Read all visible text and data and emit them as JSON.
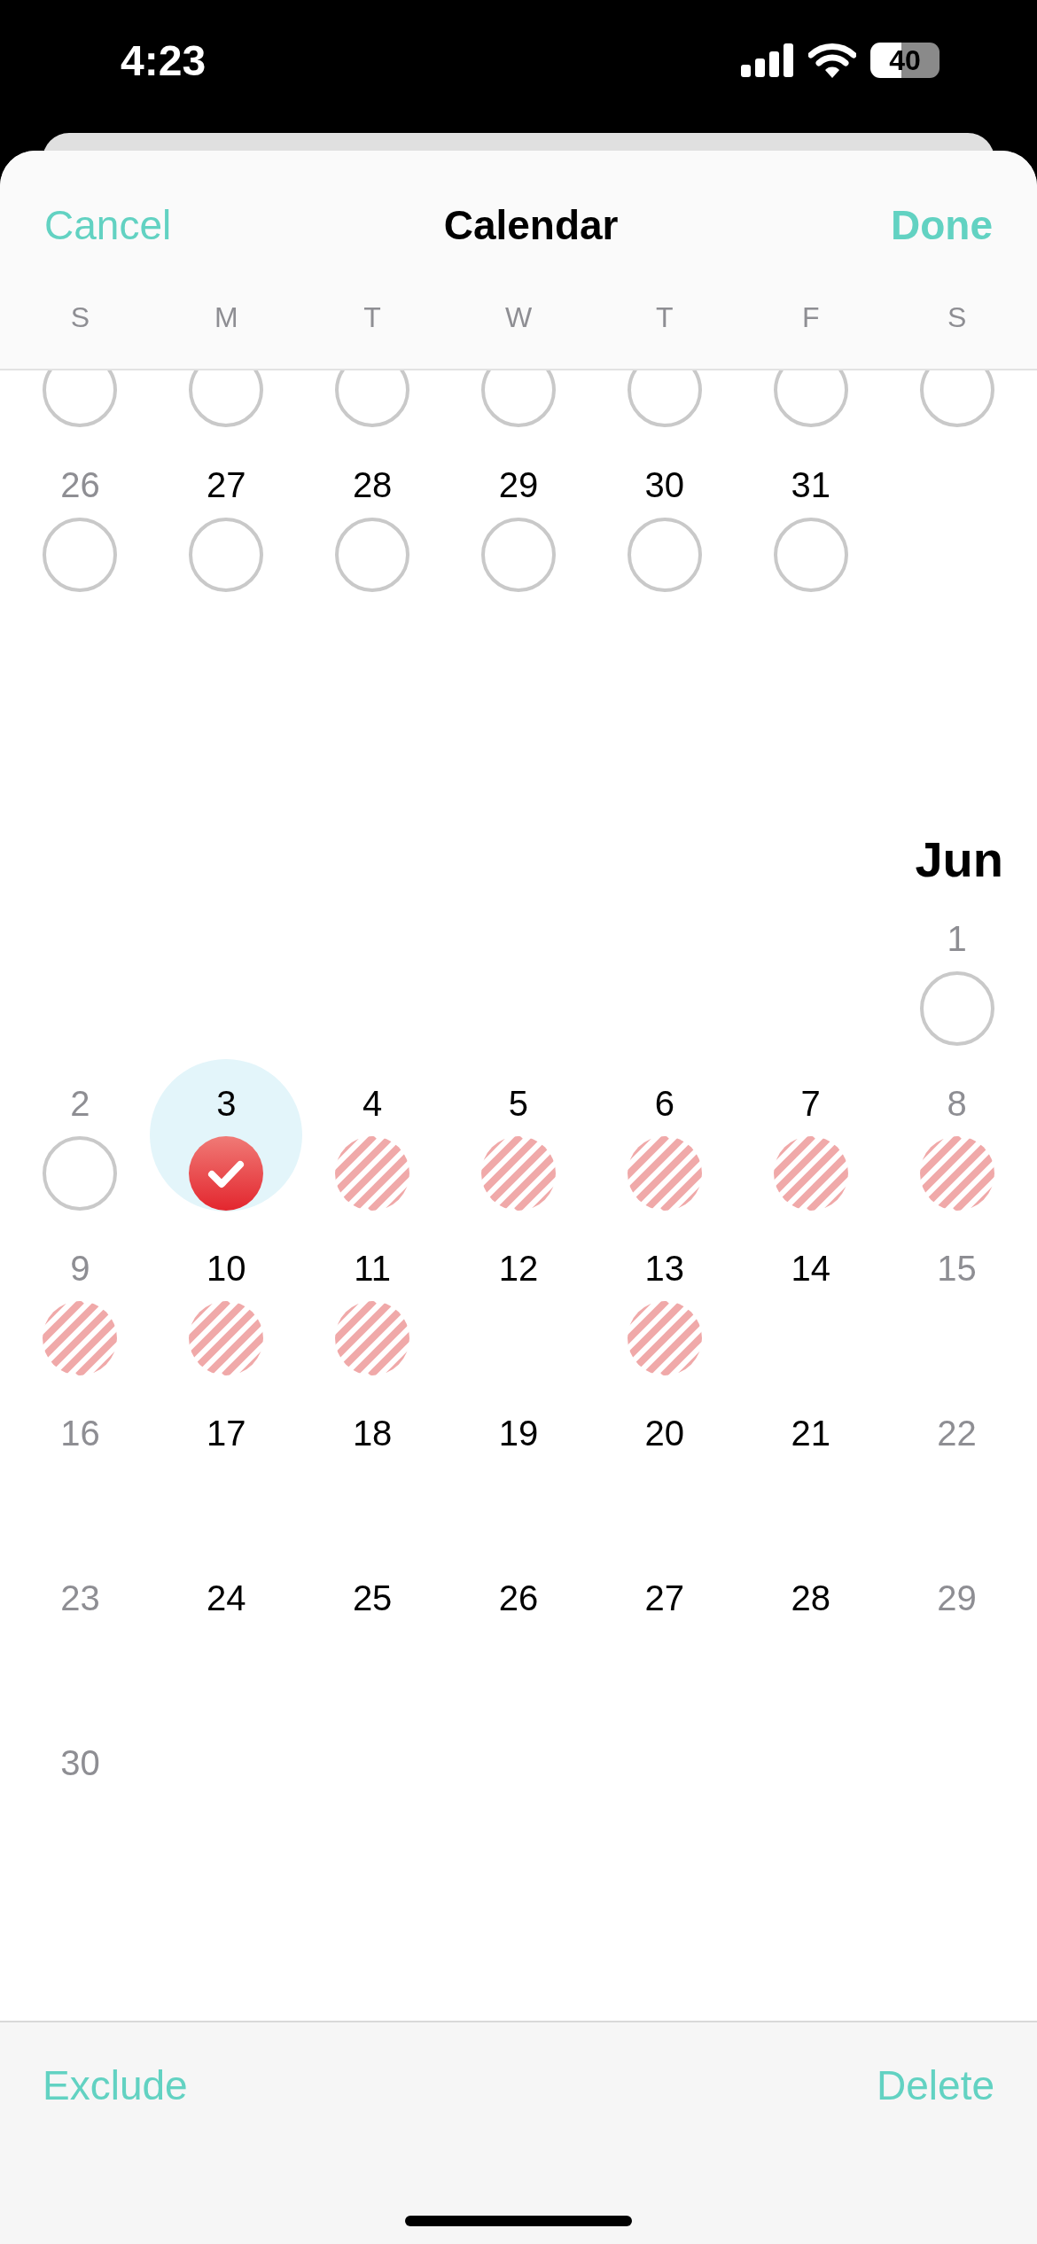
{
  "status_bar": {
    "time": "4:23",
    "battery": "40"
  },
  "header": {
    "cancel": "Cancel",
    "title": "Calendar",
    "done": "Done"
  },
  "weekdays": [
    "S",
    "M",
    "T",
    "W",
    "T",
    "F",
    "S"
  ],
  "months": [
    {
      "weeks": [
        [
          {
            "kind": "open"
          },
          {
            "kind": "open"
          },
          {
            "kind": "open"
          },
          {
            "kind": "open"
          },
          {
            "kind": "open"
          },
          {
            "kind": "open"
          },
          {
            "kind": "open"
          }
        ],
        [
          {
            "day": "26",
            "muted": true,
            "kind": "open",
            "selected": false
          },
          {
            "day": "27",
            "muted": false,
            "kind": "open",
            "selected": false
          },
          {
            "day": "28",
            "muted": false,
            "kind": "open",
            "selected": false
          },
          {
            "day": "29",
            "muted": false,
            "kind": "open",
            "selected": false
          },
          {
            "day": "30",
            "muted": false,
            "kind": "open",
            "selected": false
          },
          {
            "day": "31",
            "muted": false,
            "kind": "open",
            "selected": false
          },
          {
            "kind": "blank"
          }
        ]
      ]
    },
    {
      "title": "Jun",
      "weeks": [
        [
          {
            "kind": "blank"
          },
          {
            "kind": "blank"
          },
          {
            "kind": "blank"
          },
          {
            "kind": "blank"
          },
          {
            "kind": "blank"
          },
          {
            "kind": "blank"
          },
          {
            "day": "1",
            "muted": true,
            "kind": "open",
            "selected": false
          }
        ],
        [
          {
            "day": "2",
            "muted": true,
            "kind": "open",
            "selected": false
          },
          {
            "day": "3",
            "muted": false,
            "kind": "checked",
            "selected": true
          },
          {
            "day": "4",
            "muted": false,
            "kind": "excluded",
            "selected": false
          },
          {
            "day": "5",
            "muted": false,
            "kind": "excluded",
            "selected": false
          },
          {
            "day": "6",
            "muted": false,
            "kind": "excluded",
            "selected": false
          },
          {
            "day": "7",
            "muted": false,
            "kind": "excluded",
            "selected": false
          },
          {
            "day": "8",
            "muted": true,
            "kind": "excluded",
            "selected": false
          }
        ],
        [
          {
            "day": "9",
            "muted": true,
            "kind": "excluded",
            "selected": false
          },
          {
            "day": "10",
            "muted": false,
            "kind": "excluded",
            "selected": false
          },
          {
            "day": "11",
            "muted": false,
            "kind": "excluded",
            "selected": false
          },
          {
            "day": "12",
            "muted": false,
            "kind": "none",
            "selected": false
          },
          {
            "day": "13",
            "muted": false,
            "kind": "excluded",
            "selected": false
          },
          {
            "day": "14",
            "muted": false,
            "kind": "none",
            "selected": false
          },
          {
            "day": "15",
            "muted": true,
            "kind": "none",
            "selected": false
          }
        ],
        [
          {
            "day": "16",
            "muted": true,
            "kind": "none",
            "selected": false
          },
          {
            "day": "17",
            "muted": false,
            "kind": "none",
            "selected": false
          },
          {
            "day": "18",
            "muted": false,
            "kind": "none",
            "selected": false
          },
          {
            "day": "19",
            "muted": false,
            "kind": "none",
            "selected": false
          },
          {
            "day": "20",
            "muted": false,
            "kind": "none",
            "selected": false
          },
          {
            "day": "21",
            "muted": false,
            "kind": "none",
            "selected": false
          },
          {
            "day": "22",
            "muted": true,
            "kind": "none",
            "selected": false
          }
        ],
        [
          {
            "day": "23",
            "muted": true,
            "kind": "none",
            "selected": false
          },
          {
            "day": "24",
            "muted": false,
            "kind": "none",
            "selected": false
          },
          {
            "day": "25",
            "muted": false,
            "kind": "none",
            "selected": false
          },
          {
            "day": "26",
            "muted": false,
            "kind": "none",
            "selected": false
          },
          {
            "day": "27",
            "muted": false,
            "kind": "none",
            "selected": false
          },
          {
            "day": "28",
            "muted": false,
            "kind": "none",
            "selected": false
          },
          {
            "day": "29",
            "muted": true,
            "kind": "none",
            "selected": false
          }
        ],
        [
          {
            "day": "30",
            "muted": true,
            "kind": "none",
            "selected": false
          },
          {
            "kind": "blank"
          },
          {
            "kind": "blank"
          },
          {
            "kind": "blank"
          },
          {
            "kind": "blank"
          },
          {
            "kind": "blank"
          },
          {
            "kind": "blank"
          }
        ]
      ]
    }
  ],
  "toolbar": {
    "exclude": "Exclude",
    "delete": "Delete"
  }
}
